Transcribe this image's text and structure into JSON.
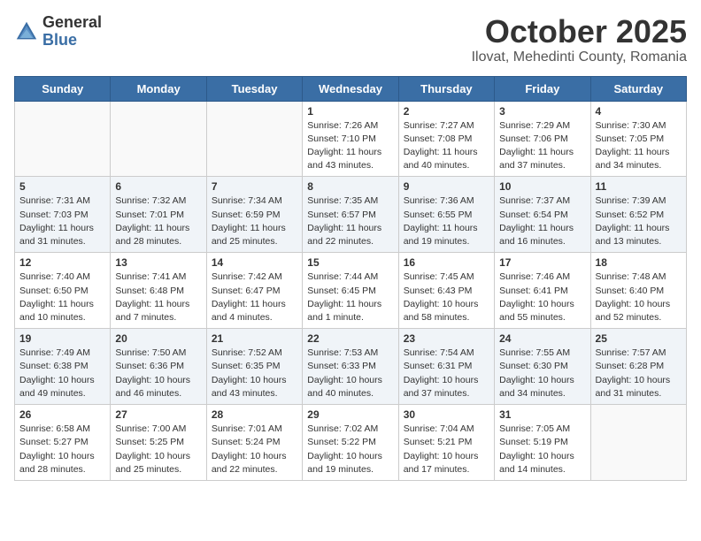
{
  "logo": {
    "general": "General",
    "blue": "Blue"
  },
  "title": "October 2025",
  "location": "Ilovat, Mehedinti County, Romania",
  "days_of_week": [
    "Sunday",
    "Monday",
    "Tuesday",
    "Wednesday",
    "Thursday",
    "Friday",
    "Saturday"
  ],
  "weeks": [
    [
      {
        "day": "",
        "info": ""
      },
      {
        "day": "",
        "info": ""
      },
      {
        "day": "",
        "info": ""
      },
      {
        "day": "1",
        "info": "Sunrise: 7:26 AM\nSunset: 7:10 PM\nDaylight: 11 hours and 43 minutes."
      },
      {
        "day": "2",
        "info": "Sunrise: 7:27 AM\nSunset: 7:08 PM\nDaylight: 11 hours and 40 minutes."
      },
      {
        "day": "3",
        "info": "Sunrise: 7:29 AM\nSunset: 7:06 PM\nDaylight: 11 hours and 37 minutes."
      },
      {
        "day": "4",
        "info": "Sunrise: 7:30 AM\nSunset: 7:05 PM\nDaylight: 11 hours and 34 minutes."
      }
    ],
    [
      {
        "day": "5",
        "info": "Sunrise: 7:31 AM\nSunset: 7:03 PM\nDaylight: 11 hours and 31 minutes."
      },
      {
        "day": "6",
        "info": "Sunrise: 7:32 AM\nSunset: 7:01 PM\nDaylight: 11 hours and 28 minutes."
      },
      {
        "day": "7",
        "info": "Sunrise: 7:34 AM\nSunset: 6:59 PM\nDaylight: 11 hours and 25 minutes."
      },
      {
        "day": "8",
        "info": "Sunrise: 7:35 AM\nSunset: 6:57 PM\nDaylight: 11 hours and 22 minutes."
      },
      {
        "day": "9",
        "info": "Sunrise: 7:36 AM\nSunset: 6:55 PM\nDaylight: 11 hours and 19 minutes."
      },
      {
        "day": "10",
        "info": "Sunrise: 7:37 AM\nSunset: 6:54 PM\nDaylight: 11 hours and 16 minutes."
      },
      {
        "day": "11",
        "info": "Sunrise: 7:39 AM\nSunset: 6:52 PM\nDaylight: 11 hours and 13 minutes."
      }
    ],
    [
      {
        "day": "12",
        "info": "Sunrise: 7:40 AM\nSunset: 6:50 PM\nDaylight: 11 hours and 10 minutes."
      },
      {
        "day": "13",
        "info": "Sunrise: 7:41 AM\nSunset: 6:48 PM\nDaylight: 11 hours and 7 minutes."
      },
      {
        "day": "14",
        "info": "Sunrise: 7:42 AM\nSunset: 6:47 PM\nDaylight: 11 hours and 4 minutes."
      },
      {
        "day": "15",
        "info": "Sunrise: 7:44 AM\nSunset: 6:45 PM\nDaylight: 11 hours and 1 minute."
      },
      {
        "day": "16",
        "info": "Sunrise: 7:45 AM\nSunset: 6:43 PM\nDaylight: 10 hours and 58 minutes."
      },
      {
        "day": "17",
        "info": "Sunrise: 7:46 AM\nSunset: 6:41 PM\nDaylight: 10 hours and 55 minutes."
      },
      {
        "day": "18",
        "info": "Sunrise: 7:48 AM\nSunset: 6:40 PM\nDaylight: 10 hours and 52 minutes."
      }
    ],
    [
      {
        "day": "19",
        "info": "Sunrise: 7:49 AM\nSunset: 6:38 PM\nDaylight: 10 hours and 49 minutes."
      },
      {
        "day": "20",
        "info": "Sunrise: 7:50 AM\nSunset: 6:36 PM\nDaylight: 10 hours and 46 minutes."
      },
      {
        "day": "21",
        "info": "Sunrise: 7:52 AM\nSunset: 6:35 PM\nDaylight: 10 hours and 43 minutes."
      },
      {
        "day": "22",
        "info": "Sunrise: 7:53 AM\nSunset: 6:33 PM\nDaylight: 10 hours and 40 minutes."
      },
      {
        "day": "23",
        "info": "Sunrise: 7:54 AM\nSunset: 6:31 PM\nDaylight: 10 hours and 37 minutes."
      },
      {
        "day": "24",
        "info": "Sunrise: 7:55 AM\nSunset: 6:30 PM\nDaylight: 10 hours and 34 minutes."
      },
      {
        "day": "25",
        "info": "Sunrise: 7:57 AM\nSunset: 6:28 PM\nDaylight: 10 hours and 31 minutes."
      }
    ],
    [
      {
        "day": "26",
        "info": "Sunrise: 6:58 AM\nSunset: 5:27 PM\nDaylight: 10 hours and 28 minutes."
      },
      {
        "day": "27",
        "info": "Sunrise: 7:00 AM\nSunset: 5:25 PM\nDaylight: 10 hours and 25 minutes."
      },
      {
        "day": "28",
        "info": "Sunrise: 7:01 AM\nSunset: 5:24 PM\nDaylight: 10 hours and 22 minutes."
      },
      {
        "day": "29",
        "info": "Sunrise: 7:02 AM\nSunset: 5:22 PM\nDaylight: 10 hours and 19 minutes."
      },
      {
        "day": "30",
        "info": "Sunrise: 7:04 AM\nSunset: 5:21 PM\nDaylight: 10 hours and 17 minutes."
      },
      {
        "day": "31",
        "info": "Sunrise: 7:05 AM\nSunset: 5:19 PM\nDaylight: 10 hours and 14 minutes."
      },
      {
        "day": "",
        "info": ""
      }
    ]
  ]
}
